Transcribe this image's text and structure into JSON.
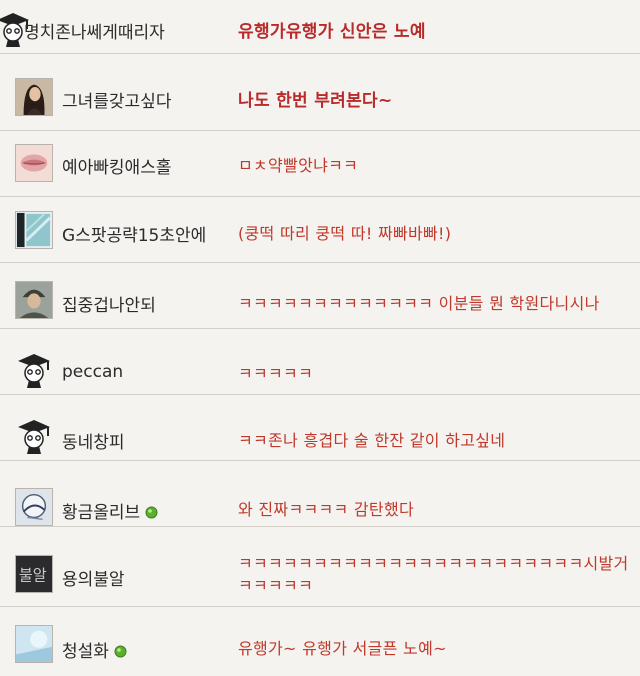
{
  "comments": [
    {
      "nickname": "명치존나쎄게때리자",
      "message": "유행가유행가 신안은 노예",
      "avatar": "grad-cap-icon",
      "online": false
    },
    {
      "nickname": "그녀를갖고싶다",
      "message": "나도 한번 부려본다~",
      "avatar": "woman-photo-icon",
      "online": false
    },
    {
      "nickname": "예아빠킹애스홀",
      "message": "ㅁㅊ약빨앗냐ㅋㅋ",
      "avatar": "lips-photo-icon",
      "online": false
    },
    {
      "nickname": "G스팟공략15초안에",
      "message": "(쿵떡 따리 쿵떡 따! 짜빠바빠!)",
      "avatar": "window-photo-icon",
      "online": false
    },
    {
      "nickname": "집중겁나안되",
      "message": "ㅋㅋㅋㅋㅋㅋㅋㅋㅋㅋㅋㅋㅋ 이분들 뭔 학원다니시나",
      "avatar": "soldier-photo-icon",
      "online": false
    },
    {
      "nickname": "peccan",
      "message": "ㅋㅋㅋㅋㅋ",
      "avatar": "grad-cap-icon",
      "online": false
    },
    {
      "nickname": "동네창피",
      "message": "ㅋㅋ존나 흥겹다 술 한잔 같이 하고싶네",
      "avatar": "grad-cap-icon",
      "online": false
    },
    {
      "nickname": "황금올리브",
      "message": "와 진짜ㅋㅋㅋㅋ 감탄했다",
      "avatar": "sketch-photo-icon",
      "online": true
    },
    {
      "nickname": "용의불알",
      "message": "ㅋㅋㅋㅋㅋㅋㅋㅋㅋㅋㅋㅋㅋㅋㅋㅋㅋㅋㅋㅋㅋㅋㅋ시발거",
      "message_line2": "ㅋㅋㅋㅋㅋ",
      "avatar": "dark-text-photo-icon",
      "online": false
    },
    {
      "nickname": "청설화",
      "message": "유행가~ 유행가 서글픈 노예~",
      "avatar": "light-blue-photo-icon",
      "online": true
    }
  ]
}
